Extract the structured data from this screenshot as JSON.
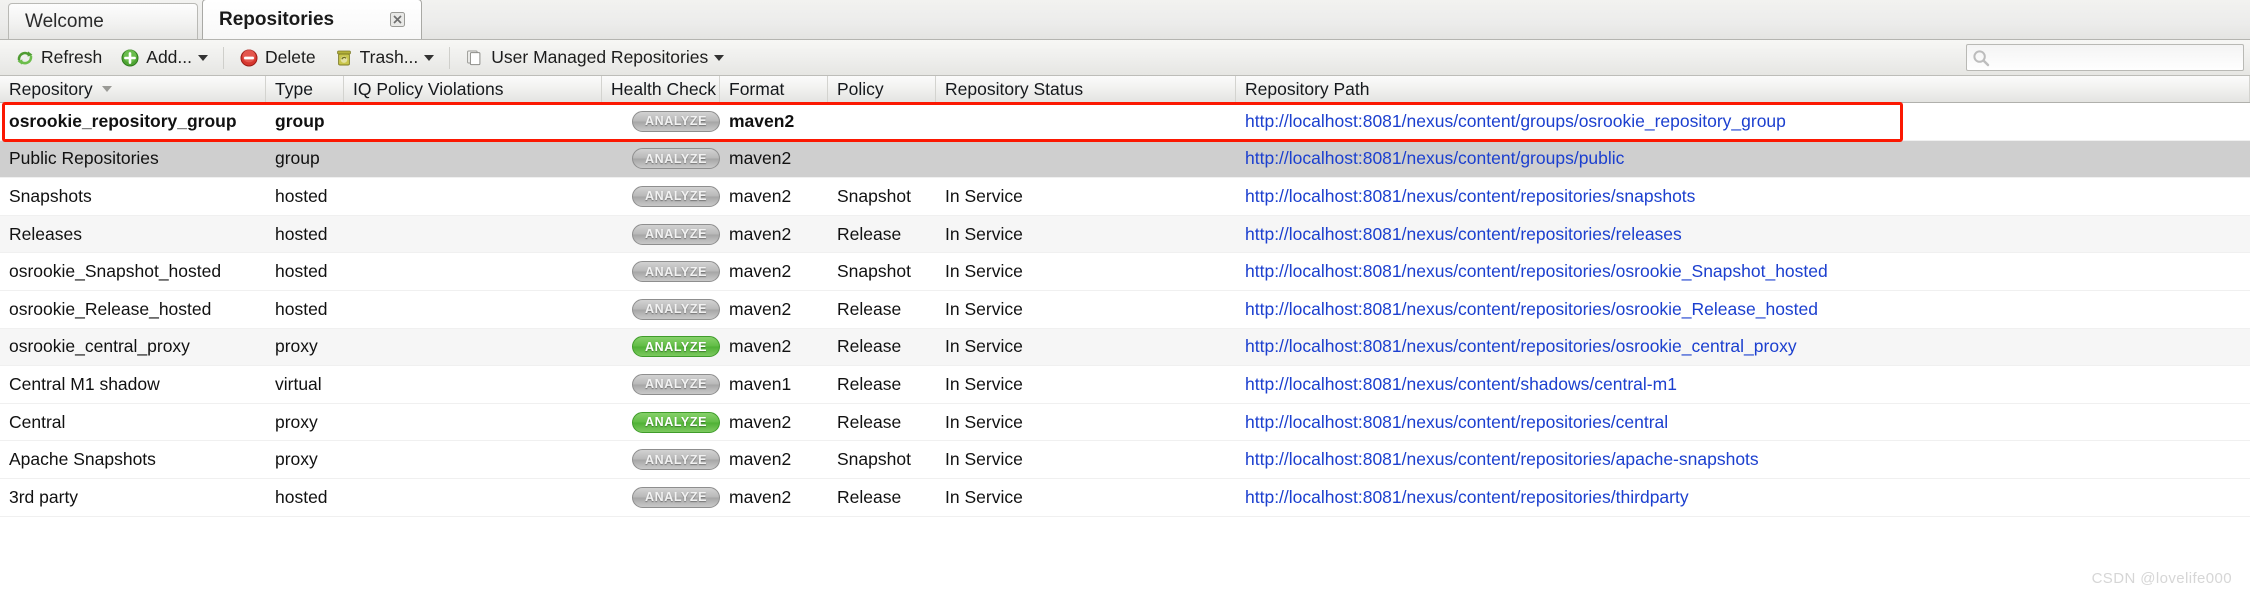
{
  "tabs": [
    {
      "label": "Welcome",
      "active": false,
      "closable": false
    },
    {
      "label": "Repositories",
      "active": true,
      "closable": true,
      "close_icon": "close-icon"
    }
  ],
  "toolbar": {
    "refresh_label": "Refresh",
    "refresh_icon": "refresh-icon",
    "add_label": "Add...",
    "add_icon": "add-circle-icon",
    "delete_label": "Delete",
    "delete_icon": "delete-circle-icon",
    "trash_label": "Trash...",
    "trash_icon": "trash-can-icon",
    "user_managed_label": "User Managed Repositories",
    "user_managed_icon": "copy-pages-icon"
  },
  "search": {
    "icon": "search-icon",
    "value": "",
    "placeholder": ""
  },
  "table": {
    "columns": [
      {
        "key": "repository",
        "label": "Repository",
        "sorted": true,
        "sort_icon": "sort-desc-icon"
      },
      {
        "key": "type",
        "label": "Type"
      },
      {
        "key": "iq_policy_violations",
        "label": "IQ Policy Violations"
      },
      {
        "key": "health_check",
        "label": "Health Check"
      },
      {
        "key": "format",
        "label": "Format"
      },
      {
        "key": "policy",
        "label": "Policy"
      },
      {
        "key": "repository_status",
        "label": "Repository Status"
      },
      {
        "key": "repository_path",
        "label": "Repository Path"
      }
    ],
    "rows": [
      {
        "repository": "osrookie_repository_group",
        "type": "group",
        "iq_policy_violations": "",
        "health_check": "ANALYZE",
        "health_state": "gray",
        "format": "maven2",
        "policy": "",
        "repository_status": "",
        "repository_path": "http://localhost:8081/nexus/content/groups/osrookie_repository_group",
        "style": "hl"
      },
      {
        "repository": "Public Repositories",
        "type": "group",
        "iq_policy_violations": "",
        "health_check": "ANALYZE",
        "health_state": "gray",
        "format": "maven2",
        "policy": "",
        "repository_status": "",
        "repository_path": "http://localhost:8081/nexus/content/groups/public",
        "style": "sel"
      },
      {
        "repository": "Snapshots",
        "type": "hosted",
        "iq_policy_violations": "",
        "health_check": "ANALYZE",
        "health_state": "gray",
        "format": "maven2",
        "policy": "Snapshot",
        "repository_status": "In Service",
        "repository_path": "http://localhost:8081/nexus/content/repositories/snapshots",
        "style": "white"
      },
      {
        "repository": "Releases",
        "type": "hosted",
        "iq_policy_violations": "",
        "health_check": "ANALYZE",
        "health_state": "gray",
        "format": "maven2",
        "policy": "Release",
        "repository_status": "In Service",
        "repository_path": "http://localhost:8081/nexus/content/repositories/releases",
        "style": "alt"
      },
      {
        "repository": "osrookie_Snapshot_hosted",
        "type": "hosted",
        "iq_policy_violations": "",
        "health_check": "ANALYZE",
        "health_state": "gray",
        "format": "maven2",
        "policy": "Snapshot",
        "repository_status": "In Service",
        "repository_path": "http://localhost:8081/nexus/content/repositories/osrookie_Snapshot_hosted",
        "style": "white"
      },
      {
        "repository": "osrookie_Release_hosted",
        "type": "hosted",
        "iq_policy_violations": "",
        "health_check": "ANALYZE",
        "health_state": "gray",
        "format": "maven2",
        "policy": "Release",
        "repository_status": "In Service",
        "repository_path": "http://localhost:8081/nexus/content/repositories/osrookie_Release_hosted",
        "style": "white"
      },
      {
        "repository": "osrookie_central_proxy",
        "type": "proxy",
        "iq_policy_violations": "",
        "health_check": "ANALYZE",
        "health_state": "green",
        "format": "maven2",
        "policy": "Release",
        "repository_status": "In Service",
        "repository_path": "http://localhost:8081/nexus/content/repositories/osrookie_central_proxy",
        "style": "alt"
      },
      {
        "repository": "Central M1 shadow",
        "type": "virtual",
        "iq_policy_violations": "",
        "health_check": "ANALYZE",
        "health_state": "gray",
        "format": "maven1",
        "policy": "Release",
        "repository_status": "In Service",
        "repository_path": "http://localhost:8081/nexus/content/shadows/central-m1",
        "style": "white"
      },
      {
        "repository": "Central",
        "type": "proxy",
        "iq_policy_violations": "",
        "health_check": "ANALYZE",
        "health_state": "green",
        "format": "maven2",
        "policy": "Release",
        "repository_status": "In Service",
        "repository_path": "http://localhost:8081/nexus/content/repositories/central",
        "style": "white"
      },
      {
        "repository": "Apache Snapshots",
        "type": "proxy",
        "iq_policy_violations": "",
        "health_check": "ANALYZE",
        "health_state": "gray",
        "format": "maven2",
        "policy": "Snapshot",
        "repository_status": "In Service",
        "repository_path": "http://localhost:8081/nexus/content/repositories/apache-snapshots",
        "style": "white"
      },
      {
        "repository": "3rd party",
        "type": "hosted",
        "iq_policy_violations": "",
        "health_check": "ANALYZE",
        "health_state": "gray",
        "format": "maven2",
        "policy": "Release",
        "repository_status": "In Service",
        "repository_path": "http://localhost:8081/nexus/content/repositories/thirdparty",
        "style": "white"
      }
    ]
  },
  "highlight": {
    "color": "#fb1802",
    "target_row": 0
  },
  "watermark": {
    "text": "CSDN @lovelife000"
  }
}
